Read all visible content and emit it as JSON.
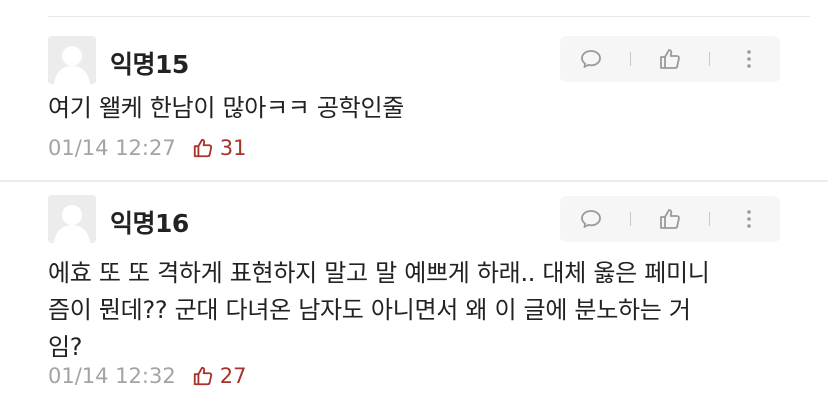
{
  "comments": [
    {
      "username": "익명15",
      "body": "여기 왤케 한남이 많아ㅋㅋ 공학인줄",
      "date": "01/14 12:27",
      "likes": "31"
    },
    {
      "username": "익명16",
      "body": "에효 또 또 격하게 표현하지 말고 말 예쁘게 하래.. 대체 옳은 페미니\n즘이 뭔데?? 군대 다녀온 남자도 아니면서 왜 이 글에 분노하는 거\n임?",
      "date": "01/14 12:32",
      "likes": "27"
    }
  ],
  "icons": {
    "reply": "speech-bubble-icon",
    "like": "thumbs-up-icon",
    "more": "vertical-dots-icon"
  },
  "colors": {
    "like_count": "#a8332b",
    "meta_text": "#a3a3a3",
    "action_bar_bg": "#f6f6f6"
  }
}
